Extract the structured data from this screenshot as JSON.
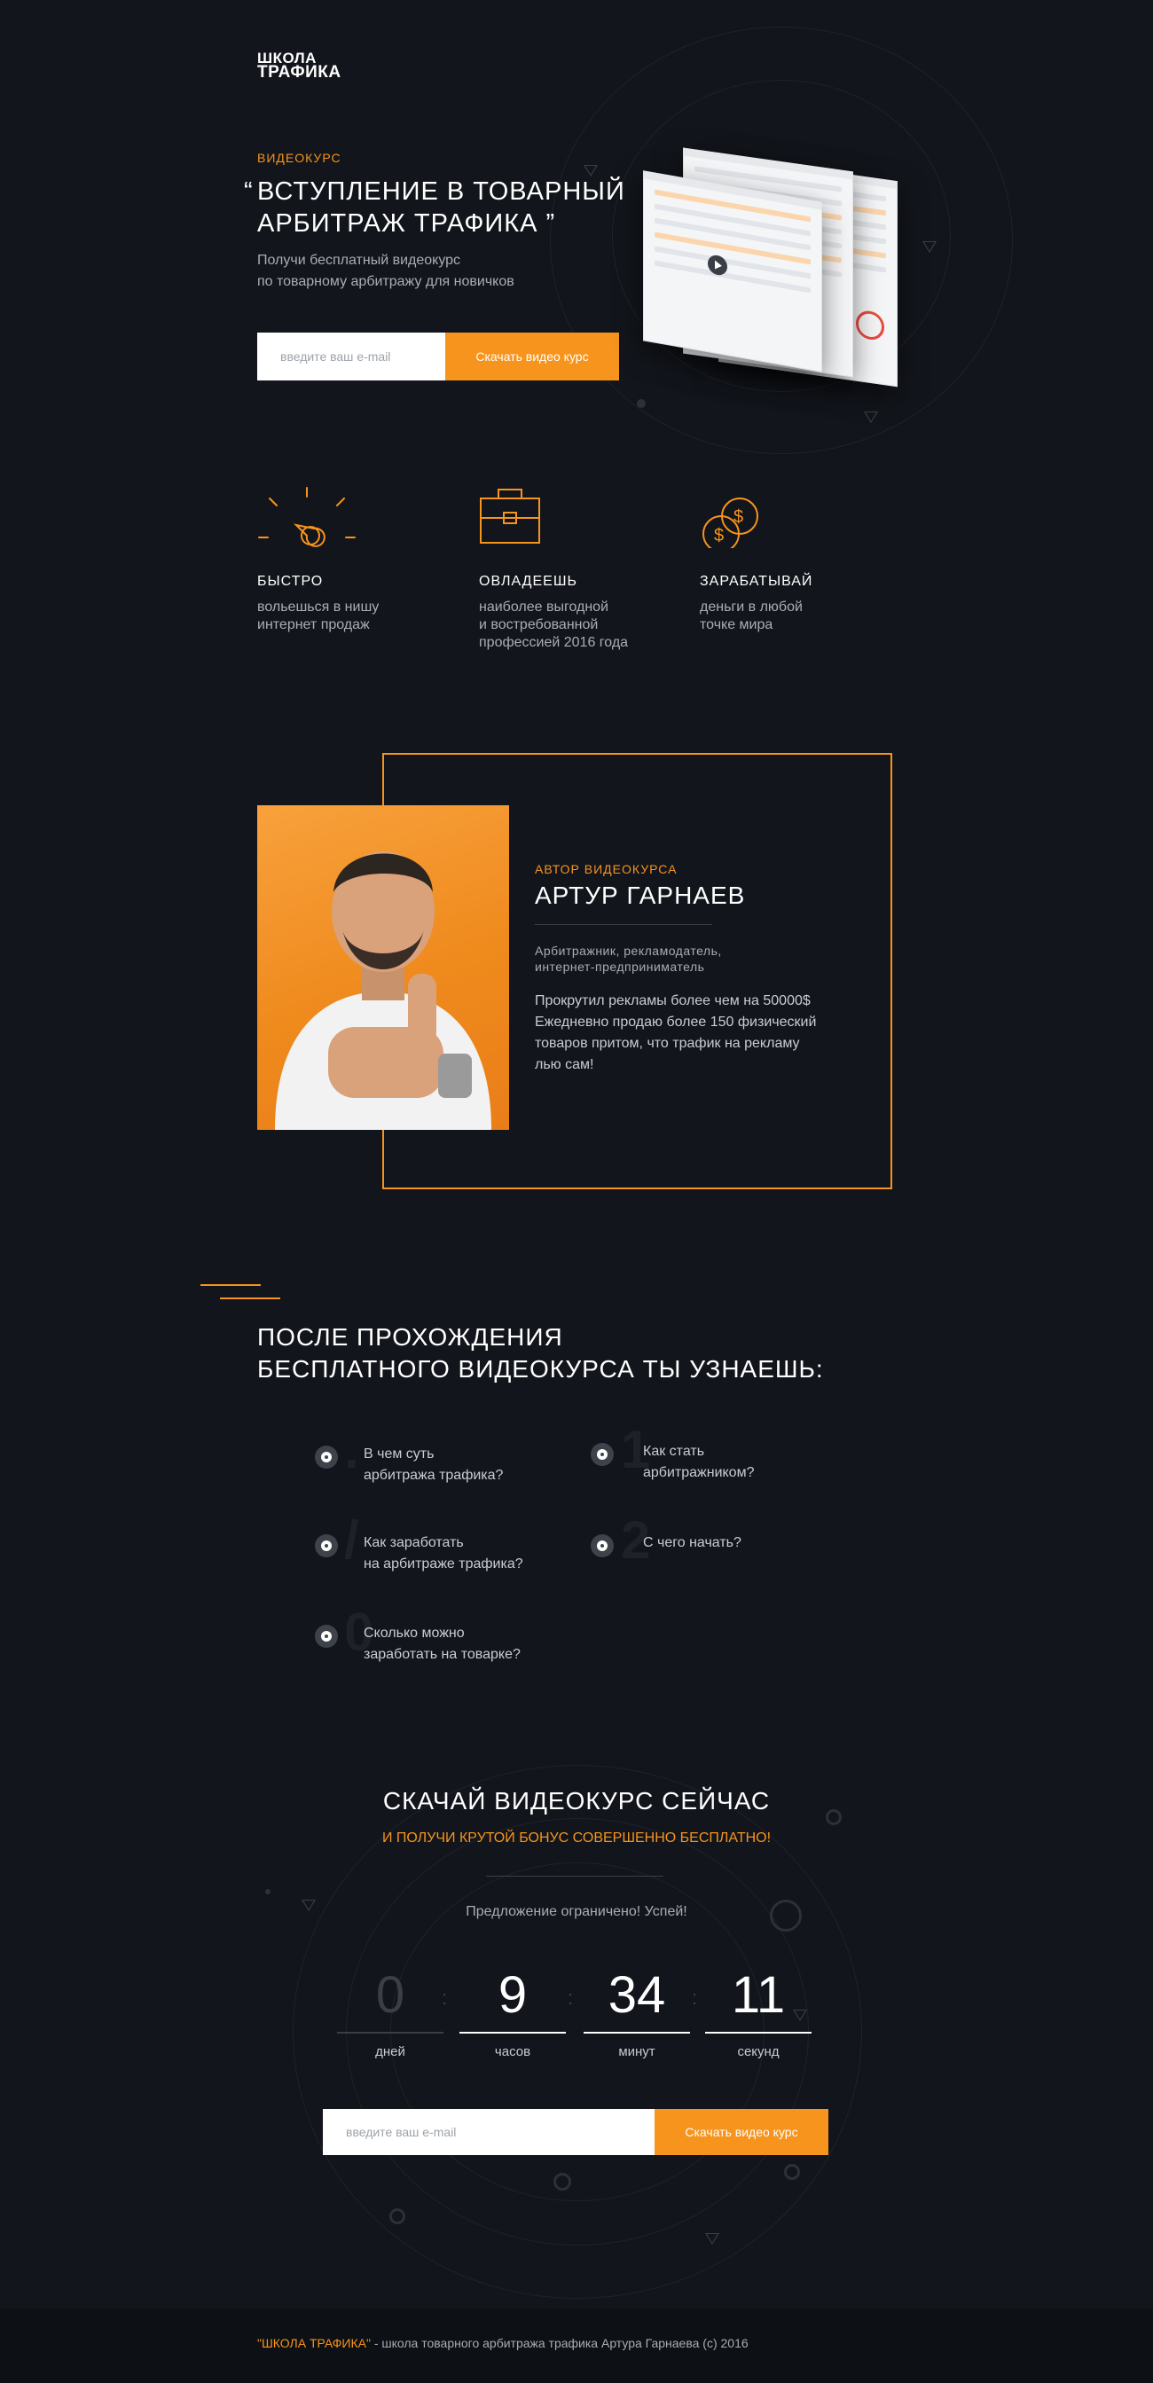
{
  "logo": {
    "line1": "ШКОЛА",
    "line2": "ТРАФИКА"
  },
  "hero": {
    "eyebrow": "ВИДЕОКУРС",
    "quote_open": "“",
    "title_line1": "ВСТУПЛЕНИЕ В ТОВАРНЫЙ",
    "title_line2": "АРБИТРАЖ ТРАФИКА",
    "quote_close": "”",
    "subtitle_line1": "Получи бесплатный видеокурс",
    "subtitle_line2": "по товарному арбитражу для новичков",
    "email_placeholder": "введите ваш e-mail",
    "button_label": "Скачать видео курс"
  },
  "features": [
    {
      "icon": "clock-speed-icon",
      "title": "БЫСТРО",
      "line1": "вольешься в нишу",
      "line2": "интернет продаж",
      "line3": ""
    },
    {
      "icon": "briefcase-icon",
      "title": "ОВЛАДЕЕШЬ",
      "line1": "наиболее выгодной",
      "line2": "и востребованной",
      "line3": "профессией 2016 года"
    },
    {
      "icon": "coins-icon",
      "title": "ЗАРАБАТЫВАЙ",
      "line1": "деньги в любой",
      "line2": "точке мира",
      "line3": ""
    }
  ],
  "author": {
    "eyebrow": "АВТОР ВИДЕОКУРСА",
    "name": "АРТУР ГАРНАЕВ",
    "role_line1": "Арбитражник, рекламодатель,",
    "role_line2": "интернет-предприниматель",
    "bio_line1": "Прокрутил рекламы более чем на 50000$",
    "bio_line2": "Ежедневно продаю более 150 физический",
    "bio_line3": "товаров притом, что трафик на рекламу",
    "bio_line4": "лью сам!"
  },
  "learn": {
    "title_line1": "ПОСЛЕ ПРОХОЖДЕНИЯ",
    "title_line2": "БЕСПЛАТНОГО ВИДЕОКУРСА ТЫ УЗНАЕШЬ:",
    "items": [
      {
        "line1": "В чем суть",
        "line2": "арбитража трафика?"
      },
      {
        "line1": "Как стать",
        "line2": "арбитражником?"
      },
      {
        "line1": "Как заработать",
        "line2": "на арбитраже трафика?"
      },
      {
        "line1": "С чего начать?",
        "line2": ""
      },
      {
        "line1": "Сколько можно",
        "line2": "заработать на товарке?"
      }
    ]
  },
  "cta": {
    "title": "СКАЧАЙ ВИДЕОКУРС СЕЙЧАС",
    "subtitle": "И ПОЛУЧИ КРУТОЙ БОНУС СОВЕРШЕННО БЕСПЛАТНО!",
    "limited": "Предложение ограничено! Успей!",
    "countdown": [
      {
        "value": "0",
        "label": "дней"
      },
      {
        "value": "9",
        "label": "часов"
      },
      {
        "value": "34",
        "label": "минут"
      },
      {
        "value": "11",
        "label": "секунд"
      }
    ],
    "separator": ":",
    "email_placeholder": "введите ваш e-mail",
    "button_label": "Скачать видео курс"
  },
  "footer": {
    "brand": "\"ШКОЛА ТРАФИКА\"",
    "text": " - школа товарного арбитража трафика Артура Гарнаева (с) 2016"
  },
  "colors": {
    "background": "#12151b",
    "accent": "#f7941d",
    "footer_bg": "#0d1014"
  }
}
